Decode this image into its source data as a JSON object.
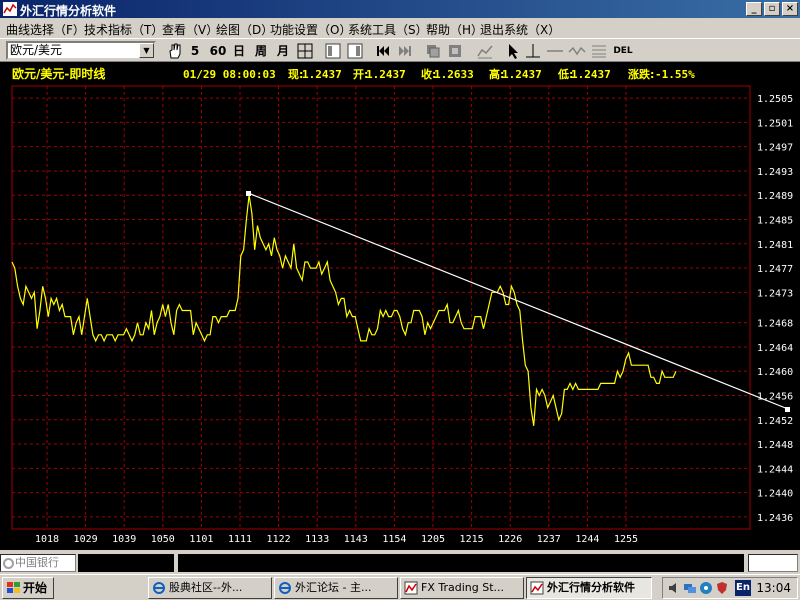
{
  "window": {
    "title": "外汇行情分析软件",
    "controls": {
      "minimize": "_",
      "restore": "▫",
      "close": "×"
    }
  },
  "menu": {
    "items": [
      "曲线选择（F）",
      "技术指标（T）",
      "查看（V）",
      "绘图（D）",
      "功能设置（O）",
      "系统工具（S）",
      "帮助（H）",
      "退出系统（X）"
    ]
  },
  "toolbar": {
    "symbol": "欧元/美元",
    "periods": [
      "5",
      "60",
      "日",
      "周",
      "月"
    ],
    "del_label": "DEL"
  },
  "quote": {
    "title": "欧元/美元-即时线",
    "datetime": "01/29 08:00:03",
    "now_label": "现:",
    "now": "1.2437",
    "open_label": "开:",
    "open": "1.2437",
    "close_label": "收:",
    "close": "1.2633",
    "high_label": "高:",
    "high": "1.2437",
    "low_label": "低:",
    "low": "1.2437",
    "change_label": "涨跌:",
    "change": "-1.55%"
  },
  "chart_data": {
    "type": "line",
    "title": "欧元/美元-即时线",
    "ylim": [
      1.2434,
      1.2507
    ],
    "y_ticks": [
      "1.2505",
      "1.2501",
      "1.2497",
      "1.2493",
      "1.2489",
      "1.2485",
      "1.2481",
      "1.2477",
      "1.2473",
      "1.2468",
      "1.2464",
      "1.2460",
      "1.2456",
      "1.2452",
      "1.2448",
      "1.2444",
      "1.2440",
      "1.2436"
    ],
    "x_ticks": [
      "1018",
      "1029",
      "1039",
      "1050",
      "1101",
      "1111",
      "1122",
      "1133",
      "1143",
      "1154",
      "1205",
      "1215",
      "1226",
      "1237",
      "1244",
      "1255"
    ],
    "series": [
      {
        "color": "#ffff00",
        "values": [
          1.2478,
          1.2477,
          1.2474,
          1.2472,
          1.2471,
          1.2474,
          1.2473,
          1.2472,
          1.2473,
          1.2467,
          1.247,
          1.2474,
          1.2472,
          1.2469,
          1.2472,
          1.2471,
          1.2472,
          1.247,
          1.2471,
          1.2469,
          1.2469,
          1.2469,
          1.2466,
          1.2468,
          1.2469,
          1.2466,
          1.2469,
          1.2472,
          1.2469,
          1.2466,
          1.2465,
          1.2466,
          1.2466,
          1.2465,
          1.2466,
          1.2466,
          1.2466,
          1.2465,
          1.2466,
          1.2466,
          1.2466,
          1.2467,
          1.2466,
          1.2465,
          1.2466,
          1.2468,
          1.2466,
          1.2466,
          1.2468,
          1.2467,
          1.247,
          1.2466,
          1.2468,
          1.2469,
          1.2471,
          1.2469,
          1.2471,
          1.2468,
          1.2466,
          1.247,
          1.2471,
          1.247,
          1.247,
          1.247,
          1.247,
          1.2466,
          1.2468,
          1.2467,
          1.2466,
          1.2465,
          1.2466,
          1.2466,
          1.2469,
          1.2469,
          1.2468,
          1.2469,
          1.2469,
          1.2469,
          1.247,
          1.247,
          1.247,
          1.2472,
          1.2479,
          1.248,
          1.2485,
          1.2489,
          1.2486,
          1.248,
          1.2484,
          1.2482,
          1.2481,
          1.248,
          1.2481,
          1.2479,
          1.2482,
          1.248,
          1.2479,
          1.2477,
          1.2479,
          1.2478,
          1.2477,
          1.2481,
          1.2477,
          1.2476,
          1.2475,
          1.2478,
          1.2478,
          1.2477,
          1.2477,
          1.2477,
          1.2478,
          1.2476,
          1.2477,
          1.2478,
          1.2475,
          1.2474,
          1.2473,
          1.2471,
          1.2472,
          1.2472,
          1.2469,
          1.247,
          1.2469,
          1.2469,
          1.2467,
          1.2465,
          1.2465,
          1.2465,
          1.2467,
          1.2466,
          1.2466,
          1.2467,
          1.247,
          1.2469,
          1.247,
          1.2469,
          1.2469,
          1.247,
          1.247,
          1.2469,
          1.2467,
          1.2466,
          1.2468,
          1.2468,
          1.247,
          1.247,
          1.247,
          1.2469,
          1.2466,
          1.2468,
          1.2467,
          1.2468,
          1.2469,
          1.247,
          1.247,
          1.247,
          1.2471,
          1.2468,
          1.2468,
          1.2469,
          1.247,
          1.2468,
          1.2467,
          1.2467,
          1.2467,
          1.2467,
          1.2469,
          1.2469,
          1.2469,
          1.2467,
          1.2469,
          1.2471,
          1.2473,
          1.2473,
          1.2473,
          1.2474,
          1.2473,
          1.2471,
          1.2471,
          1.2474,
          1.2473,
          1.2471,
          1.247,
          1.2465,
          1.2461,
          1.246,
          1.2454,
          1.2451,
          1.2457,
          1.2456,
          1.2457,
          1.2456,
          1.2454,
          1.2455,
          1.2456,
          1.2454,
          1.2452,
          1.2453,
          1.2457,
          1.2457,
          1.2458,
          1.2457,
          1.2458,
          1.2457,
          1.2457,
          1.2457,
          1.2457,
          1.2457,
          1.2457,
          1.2457,
          1.2457,
          1.2458,
          1.2458,
          1.2458,
          1.2458,
          1.2458,
          1.2458,
          1.246,
          1.2459,
          1.246,
          1.2462,
          1.2463,
          1.2461,
          1.2461,
          1.2461,
          1.2461,
          1.2461,
          1.2461,
          1.2461,
          1.2459,
          1.2459,
          1.2458,
          1.2458,
          1.246,
          1.2459,
          1.2459,
          1.2459,
          1.2459,
          1.246
        ]
      }
    ],
    "trendline": {
      "color": "#ffffff"
    },
    "grid": true,
    "grid_color": "#a00000"
  },
  "statusbar": {
    "bank_label": "中国银行"
  },
  "taskbar": {
    "start_label": "开始",
    "tasks": [
      "股典社区--外...",
      "外汇论坛 - 主...",
      "FX Trading St...",
      "外汇行情分析软件"
    ],
    "lang": "En",
    "clock": "13:04"
  }
}
